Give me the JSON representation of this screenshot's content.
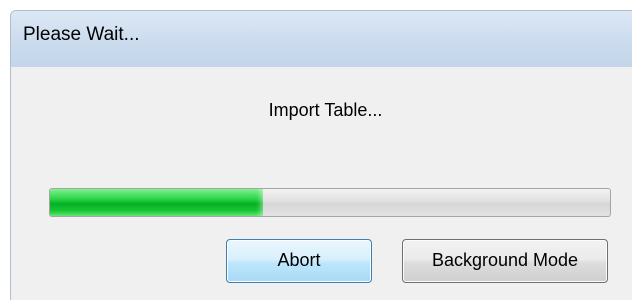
{
  "window": {
    "title": "Please Wait..."
  },
  "message": "Import Table...",
  "progress": {
    "fraction": 0.38,
    "color": "#0cc12b"
  },
  "buttons": {
    "abort_label": "Abort",
    "background_label": "Background Mode"
  },
  "colors": {
    "titlebar": "#c9dbee",
    "dialog_background": "#f0f0f0",
    "focused_button": "#bee6fd"
  }
}
